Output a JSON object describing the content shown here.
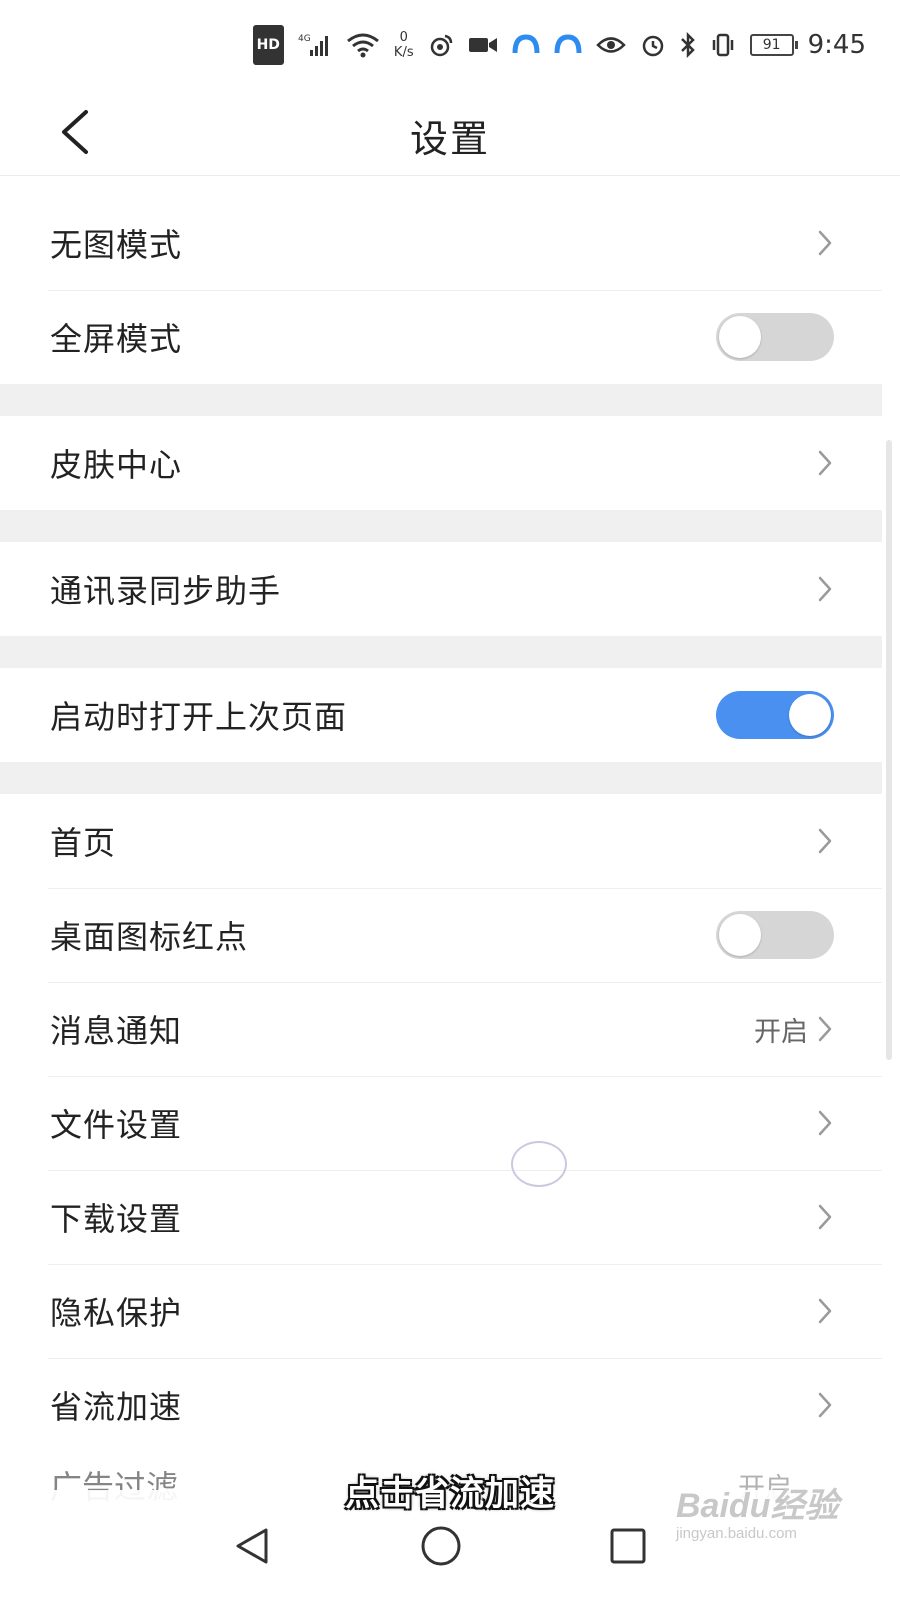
{
  "status_bar": {
    "hd": "HD",
    "network": "4G",
    "speed_value": "0",
    "speed_unit": "K/s",
    "battery": "91",
    "time": "9:45"
  },
  "header": {
    "title": "设置"
  },
  "groups": [
    {
      "items": [
        {
          "label": "无图模式",
          "control": "chevron"
        },
        {
          "label": "全屏模式",
          "control": "toggle",
          "on": false
        }
      ]
    },
    {
      "items": [
        {
          "label": "皮肤中心",
          "control": "chevron"
        }
      ]
    },
    {
      "items": [
        {
          "label": "通讯录同步助手",
          "control": "chevron"
        }
      ]
    },
    {
      "items": [
        {
          "label": "启动时打开上次页面",
          "control": "toggle",
          "on": true
        }
      ]
    },
    {
      "items": [
        {
          "label": "首页",
          "control": "chevron"
        },
        {
          "label": "桌面图标红点",
          "control": "toggle",
          "on": false
        },
        {
          "label": "消息通知",
          "control": "chevron",
          "value": "开启"
        },
        {
          "label": "文件设置",
          "control": "chevron"
        },
        {
          "label": "下载设置",
          "control": "chevron"
        },
        {
          "label": "隐私保护",
          "control": "chevron"
        },
        {
          "label": "省流加速",
          "control": "chevron"
        }
      ]
    }
  ],
  "partial_row": {
    "label": "广告过滤",
    "value": "开启"
  },
  "caption": "点击省流加速",
  "watermark": {
    "main": "Baidu经验",
    "sub": "jingyan.baidu.com"
  },
  "colors": {
    "toggle_on": "#4a90f0",
    "toggle_off": "#d6d6d6",
    "group_gap": "#f0f0f0"
  }
}
